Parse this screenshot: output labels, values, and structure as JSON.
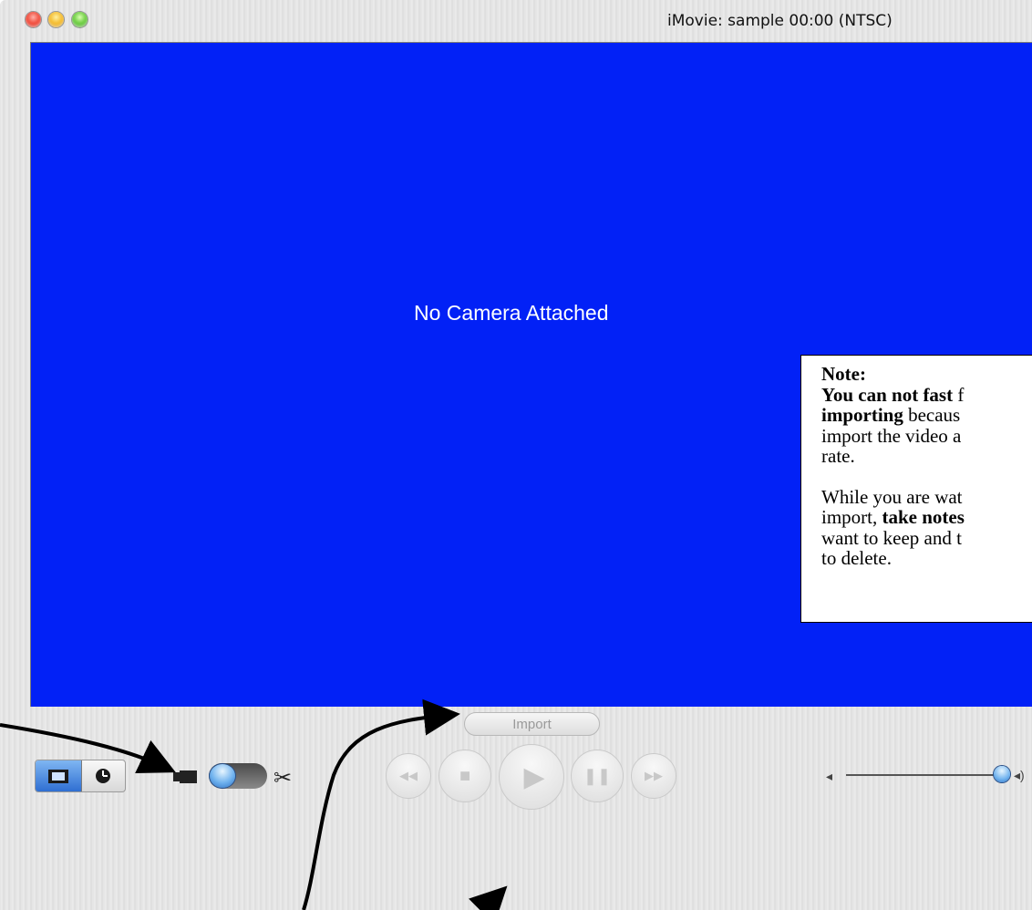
{
  "window": {
    "title": "iMovie: sample  00:00 (NTSC)"
  },
  "monitor": {
    "status_text": "No Camera Attached",
    "background_color": "#0221f6"
  },
  "note": {
    "heading": "Note:",
    "p1_bold1": "You can not fast",
    "p1_tail1": " f",
    "p1_bold2": "importing",
    "p1_tail2": " becaus",
    "p1_line3": "import the video a",
    "p1_line4": "rate.",
    "p2_line1": "While you are wat",
    "p2_line2_start": "import, ",
    "p2_line2_bold": "take notes",
    "p2_line3": "want to keep and t",
    "p2_line4": "to delete."
  },
  "controls": {
    "import_label": "Import",
    "mode_buttons": [
      "clip-viewer",
      "timeline-viewer"
    ],
    "mode_switch_left_icon": "camera-icon",
    "mode_switch_right_icon": "scissors-icon",
    "scissors_glyph": "✂",
    "playback": [
      {
        "name": "rewind-button",
        "glyph": "◀◀"
      },
      {
        "name": "stop-button",
        "glyph": "■"
      },
      {
        "name": "play-button",
        "glyph": "▶"
      },
      {
        "name": "pause-button",
        "glyph": "❚❚"
      },
      {
        "name": "fast-forward-button",
        "glyph": "▶▶"
      }
    ],
    "volume_low_glyph": "◂",
    "volume_high_glyph": "◂)",
    "accent_color": "#4a90e2"
  }
}
